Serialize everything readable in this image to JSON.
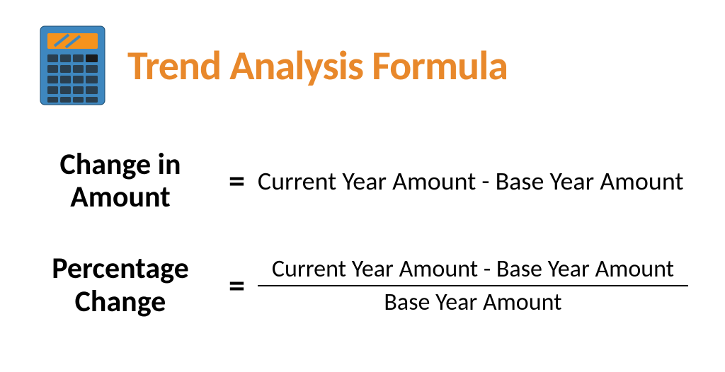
{
  "header": {
    "title": "Trend Analysis Formula"
  },
  "formula1": {
    "label_line1": "Change in",
    "label_line2": "Amount",
    "equals": "=",
    "rhs": "Current Year Amount - Base Year Amount"
  },
  "formula2": {
    "label_line1": "Percentage",
    "label_line2": "Change",
    "equals": "=",
    "numerator": "Current Year Amount - Base Year Amount",
    "denominator": "Base Year Amount"
  }
}
